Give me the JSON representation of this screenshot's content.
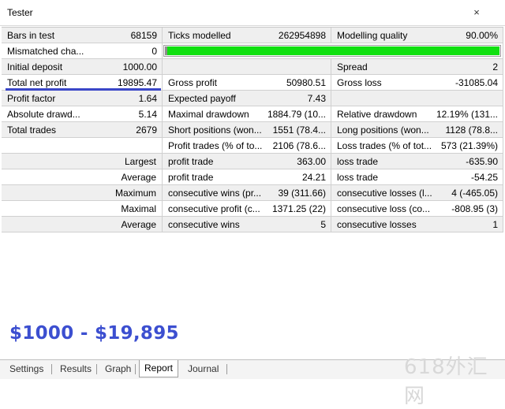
{
  "window": {
    "title": "Tester",
    "close_glyph": "×"
  },
  "rows": [
    {
      "style": "gray",
      "cells": [
        [
          "Bars in test",
          "68159"
        ],
        [
          "Ticks modelled",
          "262954898"
        ],
        [
          "Modelling quality",
          "90.00%"
        ]
      ]
    },
    {
      "style": "white",
      "cells": [
        [
          "Mismatched cha...",
          "0"
        ]
      ]
    },
    {
      "style": "gray",
      "cells": [
        [
          "Initial deposit",
          "1000.00"
        ],
        [
          "",
          ""
        ],
        [
          "Spread",
          "2"
        ]
      ]
    },
    {
      "style": "white",
      "cells": [
        [
          "Total net profit",
          "19895.47"
        ],
        [
          "Gross profit",
          "50980.51"
        ],
        [
          "Gross loss",
          "-31085.04"
        ]
      ]
    },
    {
      "style": "gray",
      "cells": [
        [
          "Profit factor",
          "1.64"
        ],
        [
          "Expected payoff",
          "7.43"
        ],
        [
          "",
          ""
        ]
      ]
    },
    {
      "style": "white",
      "cells": [
        [
          "Absolute drawd...",
          "5.14"
        ],
        [
          "Maximal drawdown",
          "1884.79 (10..."
        ],
        [
          "Relative drawdown",
          "12.19% (131..."
        ]
      ]
    },
    {
      "style": "gray",
      "cells": [
        [
          "Total trades",
          "2679"
        ],
        [
          "Short positions (won...",
          "1551 (78.4..."
        ],
        [
          "Long positions (won...",
          "1128 (78.8..."
        ]
      ]
    },
    {
      "style": "white",
      "cells": [
        [
          "",
          ""
        ],
        [
          "Profit trades (% of to...",
          "2106 (78.6..."
        ],
        [
          "Loss trades (% of tot...",
          "573 (21.39%)"
        ]
      ]
    },
    {
      "style": "gray",
      "cells": [
        [
          "Largest",
          ""
        ],
        [
          "profit trade",
          "363.00"
        ],
        [
          "loss trade",
          "-635.90"
        ]
      ]
    },
    {
      "style": "white",
      "cells": [
        [
          "Average",
          ""
        ],
        [
          "profit trade",
          "24.21"
        ],
        [
          "loss trade",
          "-54.25"
        ]
      ]
    },
    {
      "style": "gray",
      "cells": [
        [
          "Maximum",
          ""
        ],
        [
          "consecutive wins (pr...",
          "39 (311.66)"
        ],
        [
          "consecutive losses (l...",
          "4 (-465.05)"
        ]
      ]
    },
    {
      "style": "white",
      "cells": [
        [
          "Maximal",
          ""
        ],
        [
          "consecutive profit (c...",
          "1371.25 (22)"
        ],
        [
          "consecutive loss (co...",
          "-808.95 (3)"
        ]
      ]
    },
    {
      "style": "gray",
      "cells": [
        [
          "Average",
          ""
        ],
        [
          "consecutive wins",
          "5"
        ],
        [
          "consecutive losses",
          "1"
        ]
      ]
    }
  ],
  "modelling_quality_fraction": 0.99,
  "colors": {
    "progress": "#10e010",
    "highlight": "#3a46c8",
    "overlay_text": "#3c4fd0"
  },
  "overlay_text": "$1000 - $19,895",
  "tabs": [
    {
      "label": "Settings",
      "active": false
    },
    {
      "label": "Results",
      "active": false
    },
    {
      "label": "Graph",
      "active": false
    },
    {
      "label": "Report",
      "active": true
    },
    {
      "label": "Journal",
      "active": false
    }
  ],
  "watermark": "618外汇网"
}
